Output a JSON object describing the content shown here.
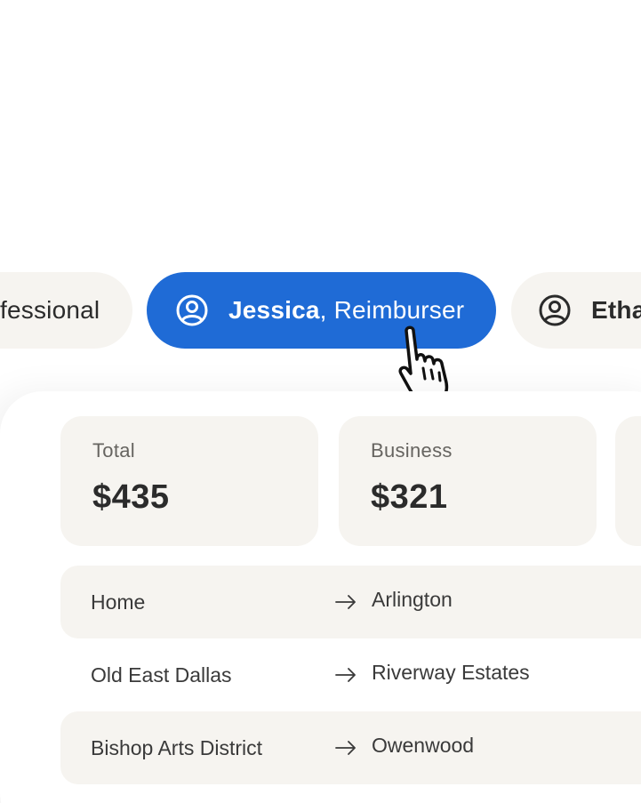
{
  "roles": {
    "left_pill": {
      "label": "fessional"
    },
    "active_pill": {
      "name": "Jessica",
      "separator": ",",
      "role": "Reimburser"
    },
    "right_pill": {
      "name": "Etha"
    }
  },
  "summary": {
    "total": {
      "label": "Total",
      "value": "$435"
    },
    "business": {
      "label": "Business",
      "value": "$321"
    }
  },
  "routes": [
    {
      "from": "Home",
      "to": "Arlington"
    },
    {
      "from": "Old East Dallas",
      "to": "Riverway Estates"
    },
    {
      "from": "Bishop Arts District",
      "to": "Owenwood"
    }
  ],
  "colors": {
    "accent": "#1f6bd6",
    "tile_bg": "#f6f4f0",
    "text": "#2b2b2b"
  },
  "icons": {
    "user": "user-circle-icon",
    "cursor": "hand-pointer-icon",
    "arrow": "arrow-right-icon"
  }
}
